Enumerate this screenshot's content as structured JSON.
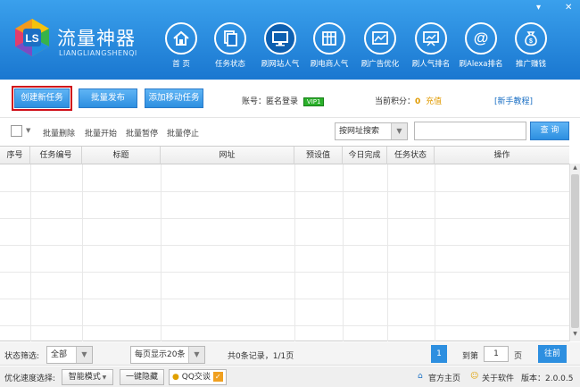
{
  "app": {
    "name": "流量神器",
    "subtitle": "LIANGLIANGSHENQI",
    "min_glyph": "▾",
    "close_glyph": "✕"
  },
  "nav": [
    {
      "label": "首  页",
      "icon": "home-icon"
    },
    {
      "label": "任务状态",
      "icon": "documents-icon"
    },
    {
      "label": "刷网站人气",
      "icon": "monitor-icon",
      "active": true
    },
    {
      "label": "刷电商人气",
      "icon": "store-icon"
    },
    {
      "label": "刷广告优化",
      "icon": "ad-window-icon"
    },
    {
      "label": "刷人气排名",
      "icon": "chart-board-icon"
    },
    {
      "label": "刷Alexa排名",
      "icon": "at-sign-icon"
    },
    {
      "label": "推广赚钱",
      "icon": "money-bag-icon"
    }
  ],
  "toolbar": {
    "create_task": "创建新任务",
    "batch_publish": "批量发布",
    "add_mobile_task": "添加移动任务",
    "account_label": "账号：",
    "account_value": "匿名登录",
    "vip": "VIP1",
    "points_label": "当前积分：",
    "points_value": "0",
    "recharge": "充值",
    "tutorial": "[新手教程]"
  },
  "filter": {
    "batch_delete": "批量删除",
    "batch_start": "批量开始",
    "batch_pause": "批量暂停",
    "batch_stop": "批量停止",
    "search_mode": "按网址搜索",
    "search_placeholder": "",
    "search_button": "查 询"
  },
  "table": {
    "columns": [
      "序号",
      "任务编号",
      "标题",
      "网址",
      "预设值",
      "今日完成",
      "任务状态",
      "操作"
    ],
    "rows": []
  },
  "pager": {
    "status_filter_label": "状态筛选:",
    "status_filter_value": "全部",
    "per_page": "每页显示20条",
    "summary": "共0条记录，1/1页",
    "current_page": "1",
    "goto_label": "到第",
    "goto_value": "1",
    "page_suffix": "页",
    "go_button": "往前"
  },
  "statusbar": {
    "speed_label": "优化速度选择:",
    "speed_value": "智能模式",
    "hide_button": "一键隐藏",
    "qq_chat": "QQ交谈",
    "official_site": "官方主页",
    "about": "关于软件",
    "version": "版本：2.0.0.5"
  },
  "colors": {
    "header": "#1a77d0",
    "accent": "#2d8fe0",
    "highlight": "#d0101a",
    "recharge": "#e09a00"
  }
}
